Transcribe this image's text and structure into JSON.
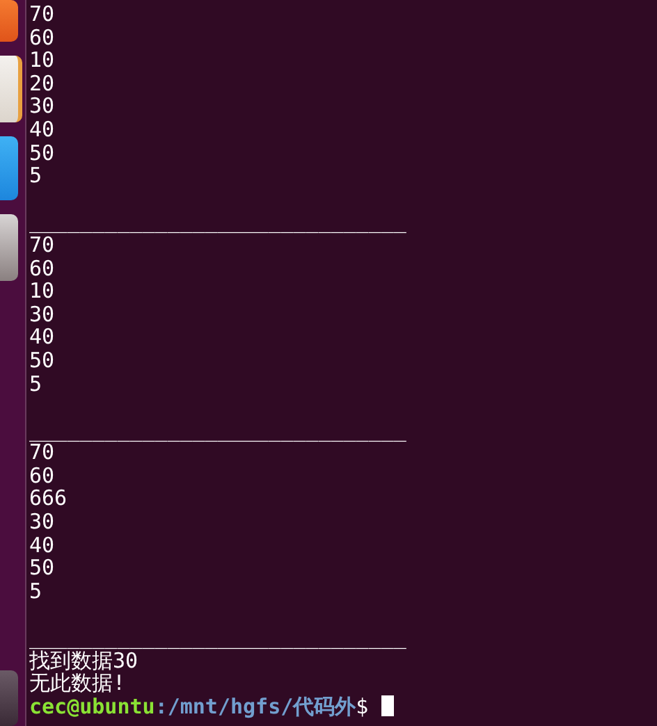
{
  "terminal": {
    "lines": [
      {
        "kind": "text",
        "text": "70"
      },
      {
        "kind": "text",
        "text": "60"
      },
      {
        "kind": "text",
        "text": "10"
      },
      {
        "kind": "text",
        "text": "20"
      },
      {
        "kind": "text",
        "text": "30"
      },
      {
        "kind": "text",
        "text": "40"
      },
      {
        "kind": "text",
        "text": "50"
      },
      {
        "kind": "text",
        "text": "5"
      },
      {
        "kind": "blank"
      },
      {
        "kind": "separator",
        "text": "______________________________"
      },
      {
        "kind": "text",
        "text": "70"
      },
      {
        "kind": "text",
        "text": "60"
      },
      {
        "kind": "text",
        "text": "10"
      },
      {
        "kind": "text",
        "text": "30"
      },
      {
        "kind": "text",
        "text": "40"
      },
      {
        "kind": "text",
        "text": "50"
      },
      {
        "kind": "text",
        "text": "5"
      },
      {
        "kind": "blank"
      },
      {
        "kind": "separator",
        "text": "______________________________"
      },
      {
        "kind": "text",
        "text": "70"
      },
      {
        "kind": "text",
        "text": "60"
      },
      {
        "kind": "text",
        "text": "666"
      },
      {
        "kind": "text",
        "text": "30"
      },
      {
        "kind": "text",
        "text": "40"
      },
      {
        "kind": "text",
        "text": "50"
      },
      {
        "kind": "text",
        "text": "5"
      },
      {
        "kind": "blank"
      },
      {
        "kind": "separator",
        "text": "______________________________"
      },
      {
        "kind": "text",
        "text": "找到数据30"
      },
      {
        "kind": "text",
        "text": "无此数据!"
      }
    ],
    "prompt": {
      "user_host": "cec@ubuntu",
      "path": ":/mnt/hgfs/代码外",
      "symbol": "$"
    }
  }
}
